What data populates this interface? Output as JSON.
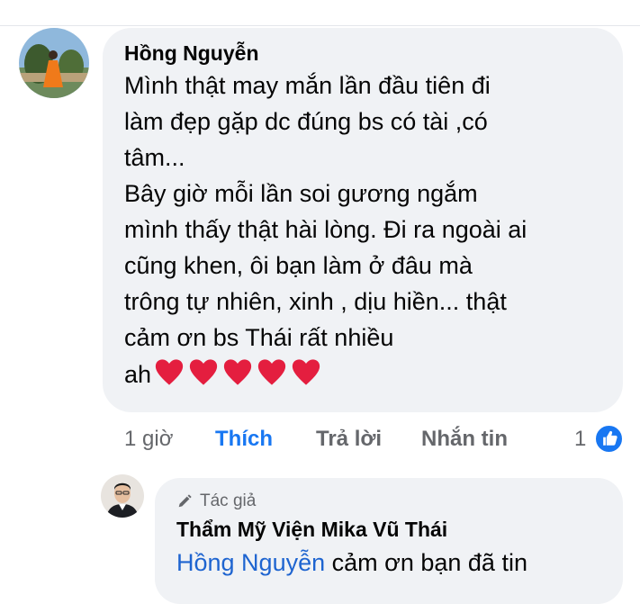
{
  "comment": {
    "author": "Hồng Nguyễn",
    "text": "Mình thật may mắn lần đầu tiên đi\nlàm đẹp gặp dc đúng bs có tài ,có\ntâm...\nBây giờ mỗi lần soi gương ngắm\nmình thấy thật hài lòng. Đi ra ngoài ai\ncũng khen, ôi bạn làm ở đâu mà\ntrông tự nhiên, xinh , dịu hiền... thật\ncảm ơn bs Thái rất nhiều\nah",
    "hearts": [
      "heart-icon",
      "heart-icon",
      "heart-icon",
      "heart-icon",
      "heart-icon"
    ],
    "heart_color": "#e41e3f"
  },
  "actions": {
    "time": "1 giờ",
    "like": "Thích",
    "reply": "Trả lời",
    "message": "Nhắn tin",
    "reaction_count": "1",
    "reaction_icon": "like-icon"
  },
  "reply": {
    "badge": "Tác giả",
    "badge_icon": "pencil-icon",
    "author": "Thẩm Mỹ Viện Mika Vũ Thái",
    "mention": "Hồng Nguyễn",
    "text": " cảm ơn bạn đã tin"
  },
  "colors": {
    "accent": "#1877f2",
    "bubble": "#f0f2f5",
    "secondary_text": "#65676b"
  }
}
